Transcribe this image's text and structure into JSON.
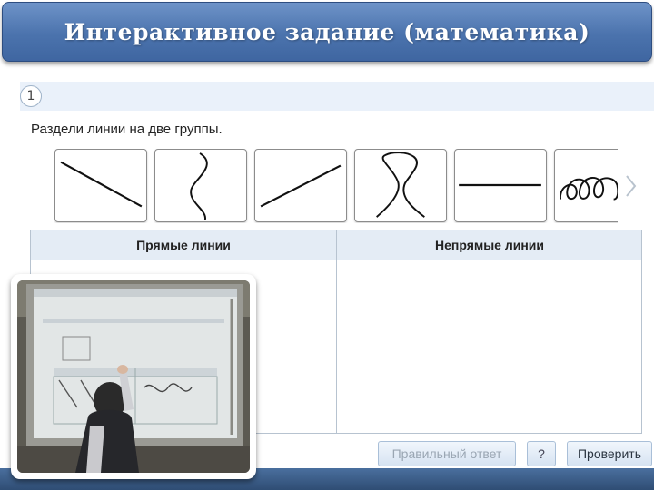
{
  "slide": {
    "title": "Интерактивное задание (математика)"
  },
  "task": {
    "number": "1",
    "instruction": "Раздели линии на две группы."
  },
  "cards": [
    {
      "icon": "straight-diagonal-line"
    },
    {
      "icon": "wavy-s-curve"
    },
    {
      "icon": "straight-rising-line"
    },
    {
      "icon": "loop-curve"
    },
    {
      "icon": "straight-horizontal-line"
    },
    {
      "icon": "spiral-loops"
    }
  ],
  "table": {
    "columns": [
      "Прямые линии",
      "Непрямые линии"
    ]
  },
  "buttons": {
    "answer": "Правильный ответ",
    "help": "?",
    "check": "Проверить"
  },
  "colors": {
    "banner": "#4b73ad",
    "task_strip": "#eaf1fa",
    "table_header": "#e4ecf5",
    "button_border": "#a9bfd8"
  }
}
